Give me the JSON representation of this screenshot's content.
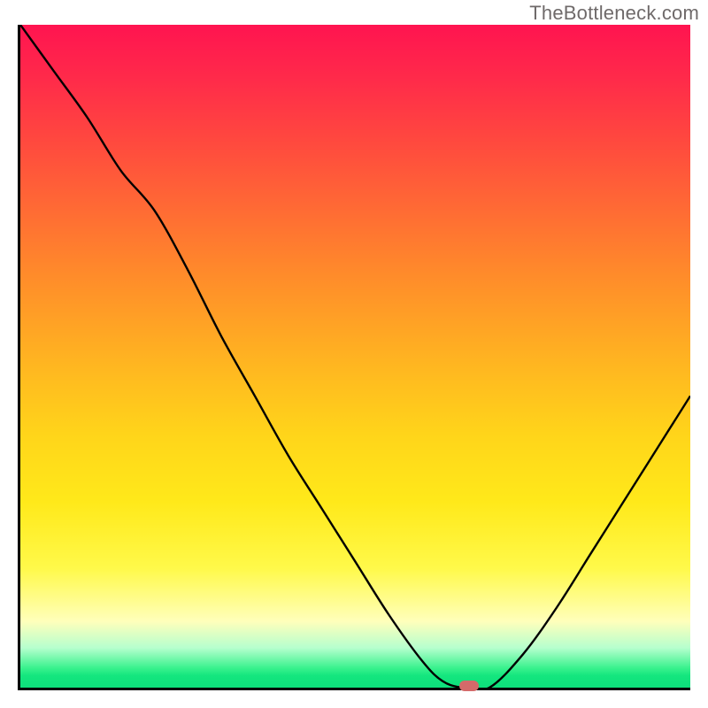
{
  "watermark": "TheBottleneck.com",
  "colors": {
    "frame": "#000000",
    "curve": "#000000",
    "marker": "#d46a6a",
    "gradient_top": "#ff1450",
    "gradient_bottom": "#0ddf7b"
  },
  "chart_data": {
    "type": "line",
    "title": "",
    "xlabel": "",
    "ylabel": "",
    "xlim": [
      0,
      100
    ],
    "ylim": [
      0,
      100
    ],
    "x": [
      0,
      5,
      10,
      15,
      20,
      25,
      30,
      35,
      40,
      45,
      50,
      55,
      60,
      63,
      66,
      70,
      75,
      80,
      85,
      90,
      95,
      100
    ],
    "values": [
      100,
      93,
      86,
      78,
      72,
      63,
      53,
      44,
      35,
      27,
      19,
      11,
      4,
      1,
      0,
      0,
      5,
      12,
      20,
      28,
      36,
      44
    ],
    "marker": {
      "x": 67,
      "y": 0.3
    },
    "legend": []
  }
}
